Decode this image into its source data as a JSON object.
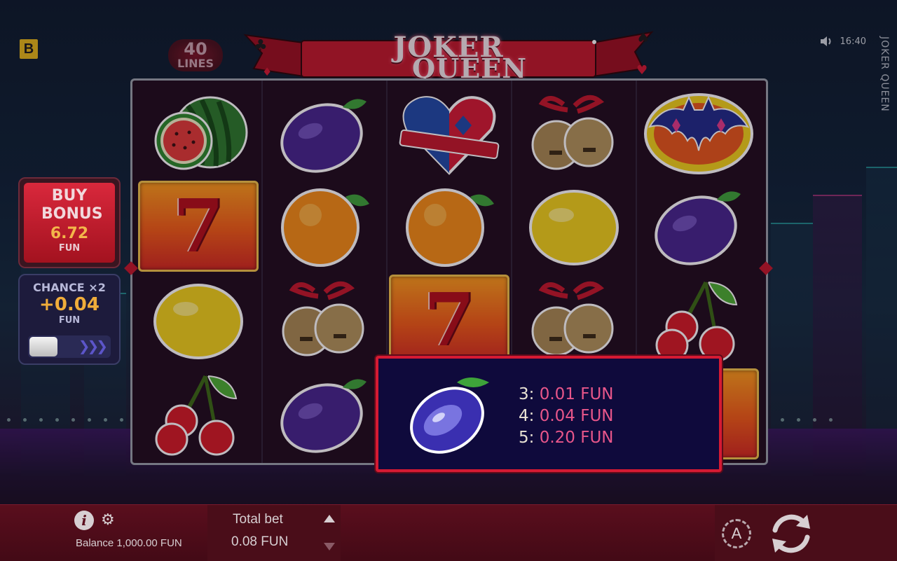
{
  "game": {
    "title_line1": "JOKER",
    "title_line2": "QUEEN",
    "vertical_title": "JOKER QUEEN",
    "lines_count": "40",
    "lines_label": "LINES",
    "brand_badge": "B"
  },
  "status": {
    "time": "16:40",
    "sound_icon": "speaker-icon"
  },
  "reels": [
    [
      "watermelon",
      "seven",
      "lemon",
      "cherries"
    ],
    [
      "plum",
      "orange",
      "bells",
      "plum"
    ],
    [
      "heart",
      "orange",
      "seven",
      ""
    ],
    [
      "bells",
      "lemon",
      "bells",
      ""
    ],
    [
      "bat-emblem",
      "plum",
      "cherries",
      "seven"
    ]
  ],
  "buy_bonus": {
    "label": "BUY BONUS",
    "amount": "6.72",
    "currency": "FUN"
  },
  "chance": {
    "label": "CHANCE ×2",
    "amount": "+0.04",
    "currency": "FUN",
    "enabled": false
  },
  "paytable": {
    "symbol": "plum",
    "rows": [
      {
        "count": "3:",
        "value": "0.01 FUN"
      },
      {
        "count": "4:",
        "value": "0.04 FUN"
      },
      {
        "count": "5:",
        "value": "0.20 FUN"
      }
    ]
  },
  "footer": {
    "balance": "Balance 1,000.00 FUN",
    "total_bet_label": "Total bet",
    "total_bet_value": "0.08 FUN",
    "auto_label": "A"
  },
  "colors": {
    "accent_red": "#d51a33",
    "gold": "#f0ad3a",
    "pink_value": "#e8568a",
    "popup_bg": "#0f0a3c"
  }
}
